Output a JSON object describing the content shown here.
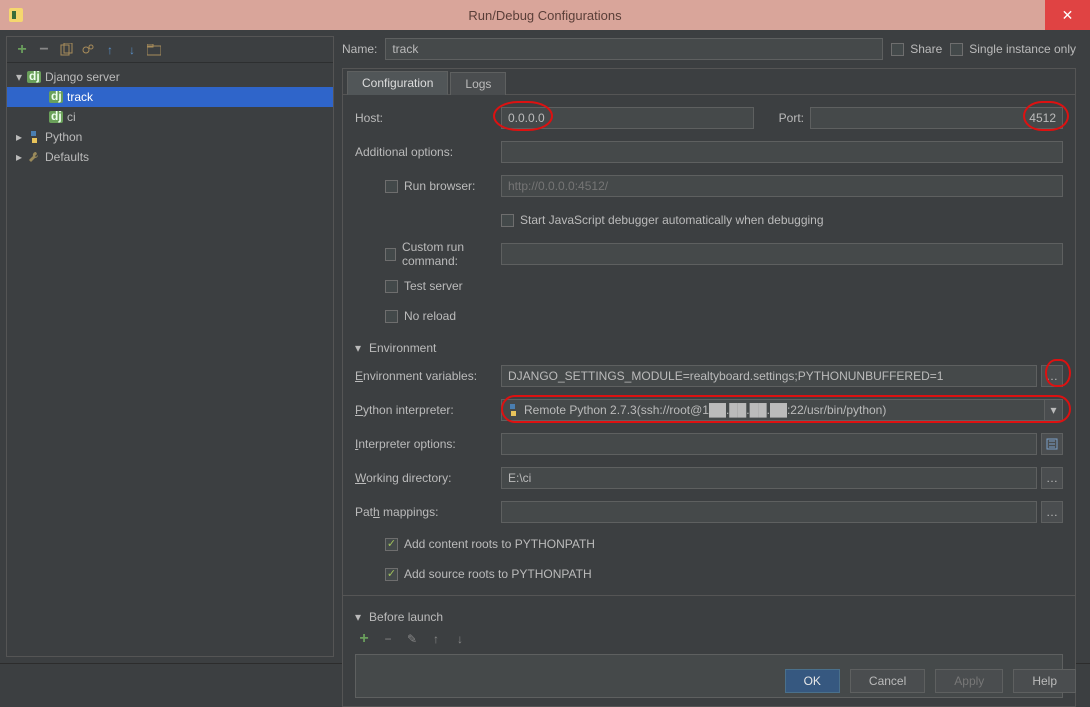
{
  "window": {
    "title": "Run/Debug Configurations"
  },
  "tree": {
    "django_server": "Django server",
    "track": "track",
    "ci": "ci",
    "python": "Python",
    "defaults": "Defaults"
  },
  "name": {
    "label": "Name:",
    "value": "track"
  },
  "share": "Share",
  "single_instance": "Single instance only",
  "tabs": {
    "configuration": "Configuration",
    "logs": "Logs"
  },
  "host": {
    "label": "Host:",
    "value": "0.0.0.0"
  },
  "port": {
    "label": "Port:",
    "value": "4512"
  },
  "additional_options": {
    "label": "Additional options:",
    "value": ""
  },
  "run_browser": {
    "label": "Run browser:",
    "placeholder": "http://0.0.0.0:4512/"
  },
  "js_debugger": "Start JavaScript debugger automatically when debugging",
  "custom_run": {
    "label": "Custom run command:",
    "value": ""
  },
  "test_server": "Test server",
  "no_reload": "No reload",
  "environment_header": "Environment",
  "env_vars": {
    "label": "Environment variables:",
    "value": "DJANGO_SETTINGS_MODULE=realtyboard.settings;PYTHONUNBUFFERED=1"
  },
  "interpreter": {
    "label": "Python interpreter:",
    "value": "Remote Python 2.7.3(ssh://root@1██.██.██.██:22/usr/bin/python)"
  },
  "interp_options": {
    "label": "Interpreter options:",
    "value": ""
  },
  "working_dir": {
    "label": "Working directory:",
    "value": "E:\\ci"
  },
  "path_mappings": {
    "label": "Path mappings:",
    "value": ""
  },
  "content_roots": "Add content roots to PYTHONPATH",
  "source_roots": "Add source roots to PYTHONPATH",
  "before_launch": "Before launch",
  "buttons": {
    "ok": "OK",
    "cancel": "Cancel",
    "apply": "Apply",
    "help": "Help"
  }
}
